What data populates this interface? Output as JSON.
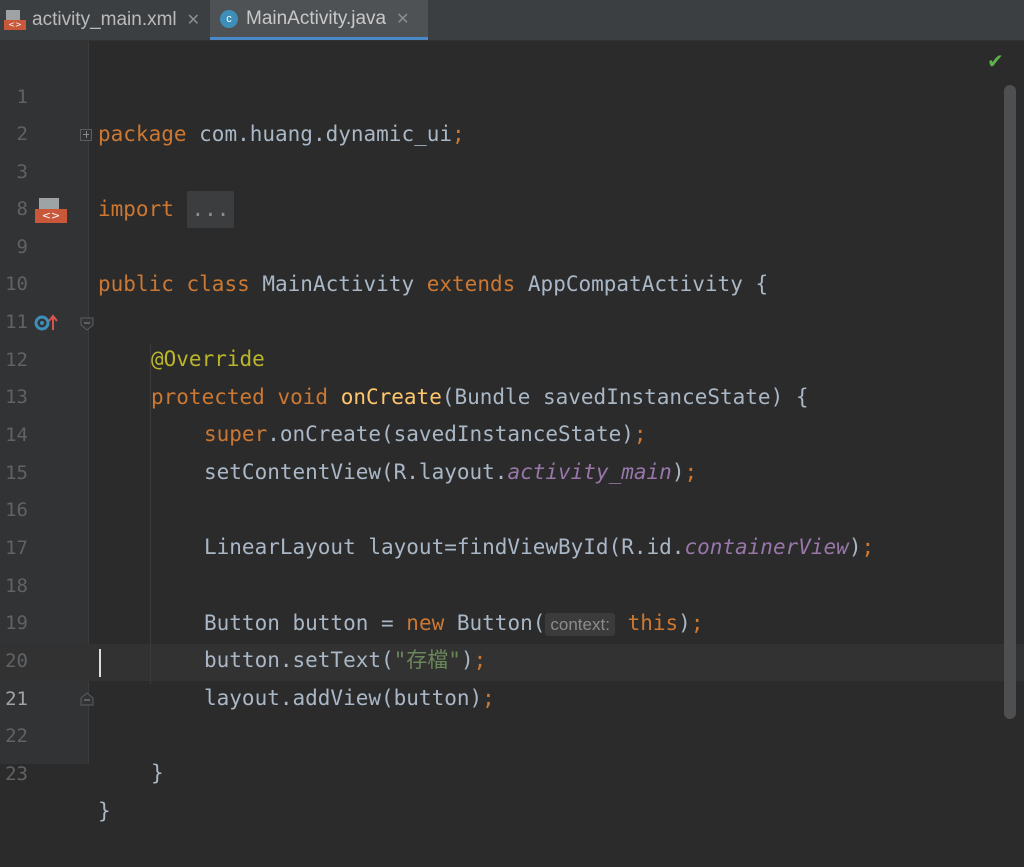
{
  "tabs": [
    {
      "label": "activity_main.xml",
      "icon": "xml-layout-icon",
      "active": false
    },
    {
      "label": "MainActivity.java",
      "icon": "java-class-icon",
      "active": true
    }
  ],
  "tab_icon_glyphs": {
    "xml": "<>",
    "class": "c"
  },
  "tab_close": "✕",
  "status": {
    "icon": "check-icon",
    "glyph": "✔"
  },
  "line_numbers": [
    "1",
    "2",
    "3",
    "8",
    "9",
    "10",
    "11",
    "12",
    "13",
    "14",
    "15",
    "16",
    "17",
    "18",
    "19",
    "20",
    "21",
    "22",
    "23"
  ],
  "active_line": "21",
  "code": {
    "l1": {
      "kw": "package",
      "text": " com.huang.dynamic_ui",
      "semi": ";"
    },
    "l3": {
      "kw": "import",
      "fold": "..."
    },
    "l9": {
      "kw1": "public",
      "kw2": "class",
      "name": " MainActivity ",
      "kw3": "extends",
      "rest": " AppCompatActivity {"
    },
    "l11": {
      "ann": "@Override"
    },
    "l12": {
      "kw1": "protected",
      "kw2": "void",
      "fn": "onCreate",
      "rest": "(Bundle savedInstanceState) {"
    },
    "l13": {
      "kw": "super",
      "rest": ".onCreate(savedInstanceState)",
      "semi": ";"
    },
    "l14": {
      "pre": "setContentView(R.layout.",
      "field": "activity_main",
      "post": ")",
      "semi": ";"
    },
    "l16": {
      "pre": "LinearLayout layout=findViewById(R.id.",
      "field": "containerView",
      "post": ")",
      "semi": ";"
    },
    "l18": {
      "pre": "Button button = ",
      "kw": "new",
      "mid": " Button(",
      "hint": "context:",
      "kw2": "this",
      "post": ")",
      "semi": ";"
    },
    "l19": {
      "pre": "button.setText(",
      "str": "\"存檔\"",
      "post": ")",
      "semi": ";"
    },
    "l20": {
      "pre": "layout.addView(button)",
      "semi": ";"
    },
    "l22": {
      "text": "}"
    },
    "l23": {
      "text": "}"
    }
  },
  "colors": {
    "background": "#2b2b2b",
    "keyword": "#cc7832",
    "annotation": "#bbb529",
    "method": "#ffc66d",
    "string": "#6a8759",
    "static_field": "#9876aa",
    "default_text": "#a9b7c6",
    "success": "#5fb04b"
  }
}
